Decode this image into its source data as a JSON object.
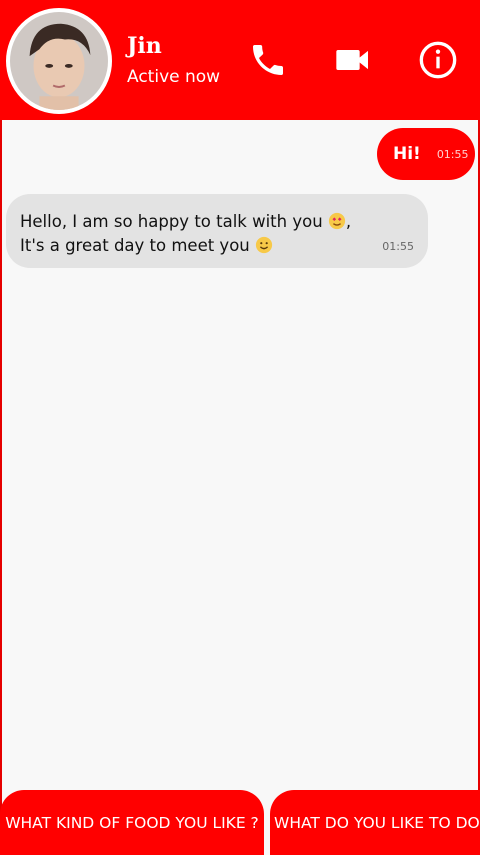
{
  "header": {
    "contact_name": "Jin",
    "status": "Active now",
    "icons": [
      "phone-icon",
      "video-camera-icon",
      "info-icon"
    ],
    "color": "#ff0000"
  },
  "messages": [
    {
      "direction": "outgoing",
      "text": "Hi!",
      "time": "01:55"
    },
    {
      "direction": "incoming",
      "line1": "Hello, I am so happy to talk with you",
      "line1_suffix": ",",
      "line2": "It's a great day to meet you",
      "time": "01:55",
      "emojis": [
        "heart-eyes-emoji",
        "smiling-emoji"
      ]
    }
  ],
  "quick_replies": [
    {
      "label": "WHAT KIND OF FOOD YOU LIKE ?"
    },
    {
      "label": "WHAT DO YOU LIKE TO DO"
    }
  ]
}
